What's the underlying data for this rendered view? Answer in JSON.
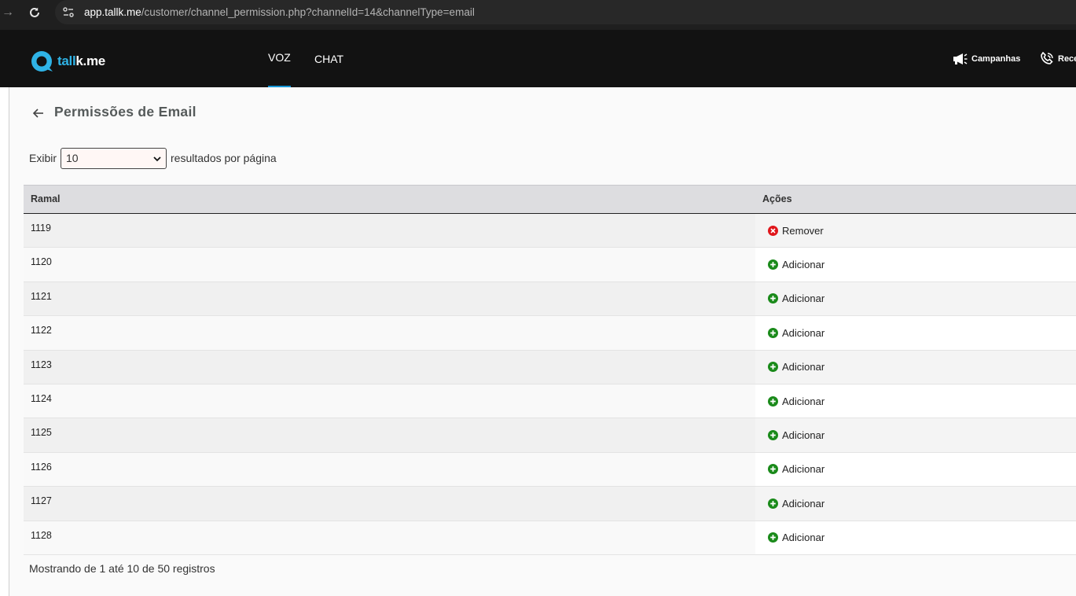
{
  "browser": {
    "url_host": "app.tallk.me",
    "url_path": "/customer/channel_permission.php?channelId=14&channelType=email"
  },
  "header": {
    "logo": {
      "prefix": "tall",
      "suffix": "k.me"
    },
    "tabs": [
      {
        "label": "VOZ",
        "active": true
      },
      {
        "label": "CHAT",
        "active": false
      }
    ],
    "right_nav": [
      {
        "label": "Campanhas",
        "icon": "megaphone-icon"
      },
      {
        "label": "Rece",
        "icon": "phone-icon"
      }
    ]
  },
  "page": {
    "title": "Permissões de Email",
    "length": {
      "prefix": "Exibir",
      "selected": "10",
      "suffix": "resultados por página"
    },
    "table": {
      "columns": [
        "Ramal",
        "Ações"
      ],
      "rows": [
        {
          "ramal": "1119",
          "action": "Remover",
          "action_type": "remove"
        },
        {
          "ramal": "1120",
          "action": "Adicionar",
          "action_type": "add"
        },
        {
          "ramal": "1121",
          "action": "Adicionar",
          "action_type": "add"
        },
        {
          "ramal": "1122",
          "action": "Adicionar",
          "action_type": "add"
        },
        {
          "ramal": "1123",
          "action": "Adicionar",
          "action_type": "add"
        },
        {
          "ramal": "1124",
          "action": "Adicionar",
          "action_type": "add"
        },
        {
          "ramal": "1125",
          "action": "Adicionar",
          "action_type": "add"
        },
        {
          "ramal": "1126",
          "action": "Adicionar",
          "action_type": "add"
        },
        {
          "ramal": "1127",
          "action": "Adicionar",
          "action_type": "add"
        },
        {
          "ramal": "1128",
          "action": "Adicionar",
          "action_type": "add"
        }
      ]
    },
    "info": "Mostrando de 1 até 10 de 50 registros"
  },
  "colors": {
    "accent": "#1596d6",
    "logo_accent": "#2fb3e6",
    "remove": "#e0161b",
    "add": "#1a8a1a"
  }
}
